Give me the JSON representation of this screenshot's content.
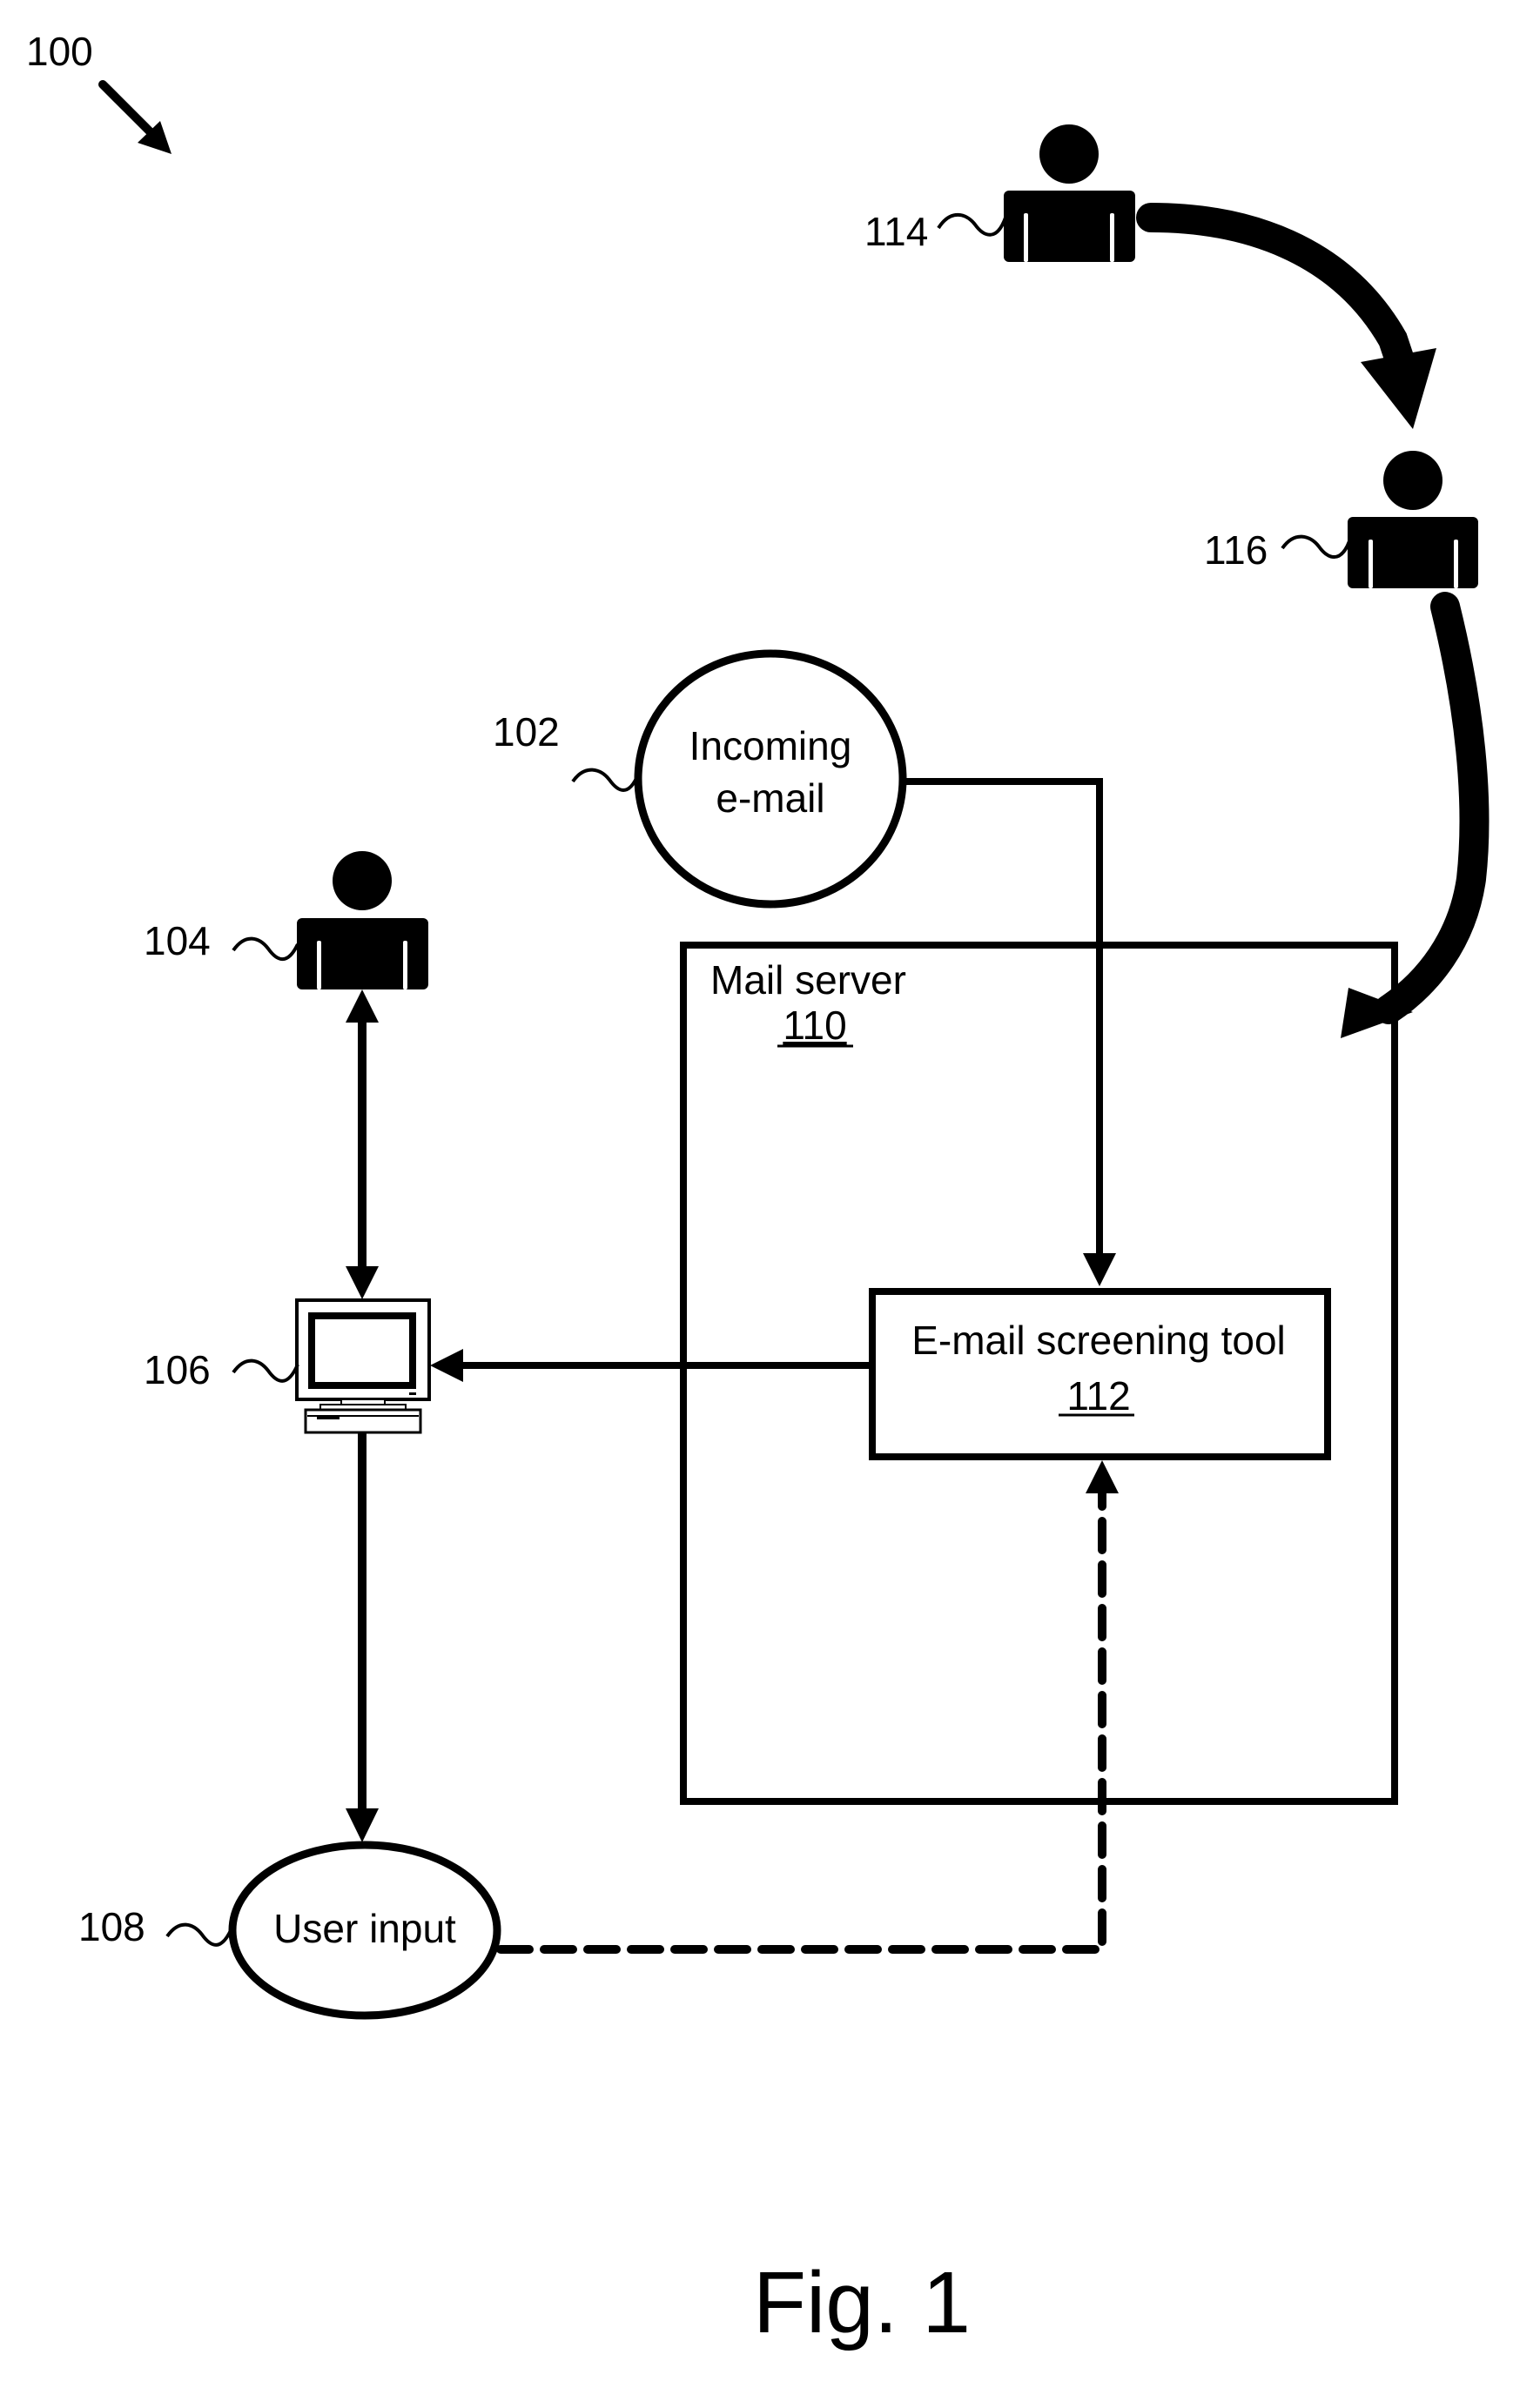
{
  "figure": {
    "number_label": "100",
    "caption": "Fig. 1",
    "ink_color": "#000000",
    "background_color": "#ffffff"
  },
  "nodes": {
    "incoming_email": {
      "ref": "102",
      "line1": "Incoming",
      "line2": "e-mail"
    },
    "user_104": {
      "ref": "104",
      "icon": "person-icon"
    },
    "computer_106": {
      "ref": "106",
      "icon": "computer-icon"
    },
    "user_input": {
      "ref": "108",
      "label": "User input"
    },
    "mail_server": {
      "ref": "110",
      "label": "Mail server"
    },
    "screening_tool": {
      "ref": "112",
      "label": "E-mail screening tool"
    },
    "sender_114": {
      "ref": "114",
      "icon": "person-icon"
    },
    "forwarder_116": {
      "ref": "116",
      "icon": "person-icon"
    }
  },
  "edges": [
    {
      "from": "114",
      "to": "116",
      "style": "thick-curved"
    },
    {
      "from": "116",
      "to": "112",
      "style": "thick-curved"
    },
    {
      "from": "102",
      "to": "112",
      "style": "solid"
    },
    {
      "from": "112",
      "to": "106",
      "style": "solid"
    },
    {
      "from": "104",
      "to": "106",
      "style": "solid-bidirectional"
    },
    {
      "from": "106",
      "to": "108",
      "style": "solid"
    },
    {
      "from": "108",
      "to": "112",
      "style": "dashed"
    }
  ]
}
